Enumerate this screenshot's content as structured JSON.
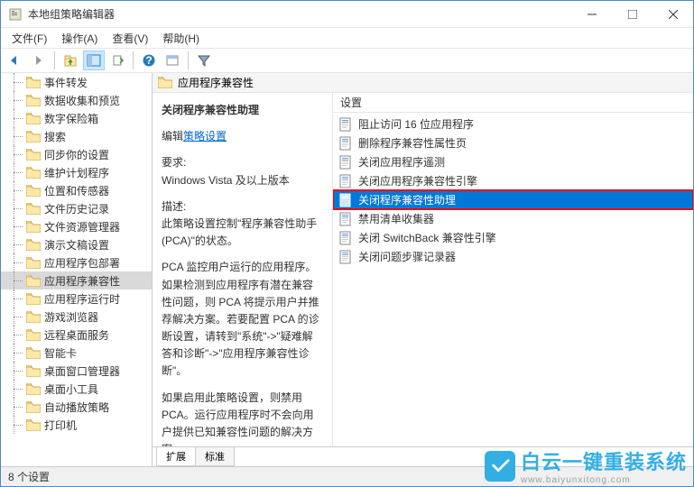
{
  "window": {
    "title": "本地组策略编辑器"
  },
  "menus": {
    "file": "文件(F)",
    "action": "操作(A)",
    "view": "查看(V)",
    "help": "帮助(H)"
  },
  "tree": {
    "items": [
      "事件转发",
      "数据收集和预览",
      "数字保险箱",
      "搜索",
      "同步你的设置",
      "维护计划程序",
      "位置和传感器",
      "文件历史记录",
      "文件资源管理器",
      "演示文稿设置",
      "应用程序包部署",
      "应用程序兼容性",
      "应用程序运行时",
      "游戏浏览器",
      "远程桌面服务",
      "智能卡",
      "桌面窗口管理器",
      "桌面小工具",
      "自动播放策略",
      "打印机"
    ],
    "selected_index": 11
  },
  "detail": {
    "header": "应用程序兼容性",
    "selected_title": "关闭程序兼容性助理",
    "edit_label": "编辑",
    "edit_link": "策略设置",
    "req_label": "要求:",
    "req_text": "Windows Vista 及以上版本",
    "desc_label": "描述:",
    "desc1": "此策略设置控制\"程序兼容性助手(PCA)\"的状态。",
    "desc2": "PCA 监控用户运行的应用程序。如果检测到应用程序有潜在兼容性问题，则 PCA 将提示用户并推荐解决方案。若要配置 PCA 的诊断设置，请转到\"系统\"->\"疑难解答和诊断\"->\"应用程序兼容性诊断\"。",
    "desc3": "如果启用此策略设置，则禁用 PCA。运行应用程序时不会向用户提供已知兼容性问题的解决方案。"
  },
  "list": {
    "header": "设置",
    "items": [
      "阻止访问 16 位应用程序",
      "删除程序兼容性属性页",
      "关闭应用程序遥测",
      "关闭应用程序兼容性引擎",
      "关闭程序兼容性助理",
      "禁用清单收集器",
      "关闭 SwitchBack 兼容性引擎",
      "关闭问题步骤记录器"
    ],
    "selected_index": 4
  },
  "tabs": {
    "extended": "扩展",
    "standard": "标准"
  },
  "status": "8 个设置",
  "watermark": {
    "text": "白云一键重装系统",
    "sub": "www.baiyunxitong.com"
  }
}
